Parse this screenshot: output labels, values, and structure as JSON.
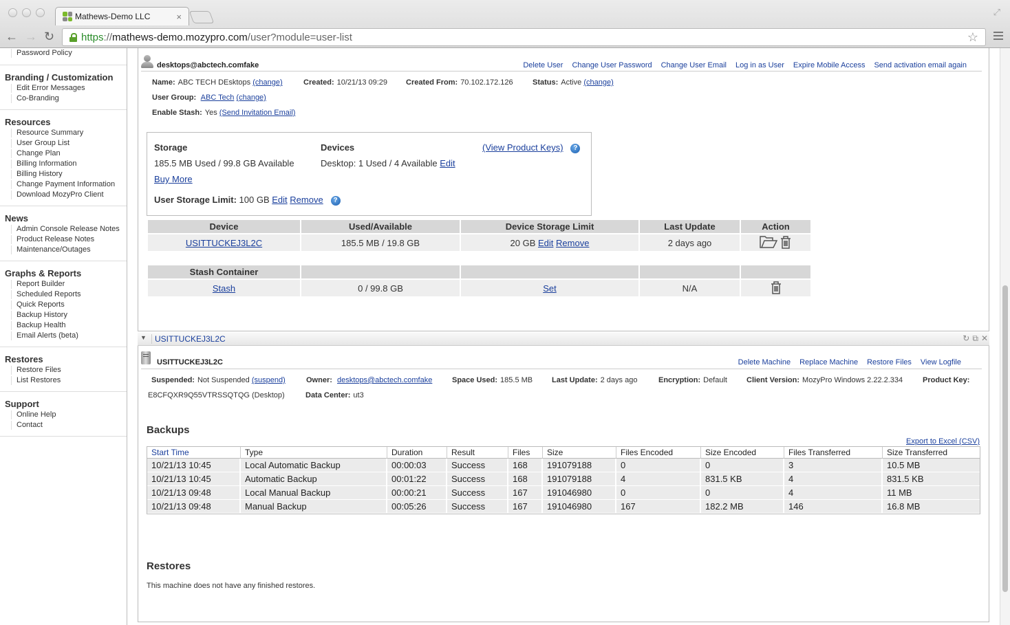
{
  "browser": {
    "tab_title": "Mathews-Demo LLC",
    "tab_close": "×",
    "url_scheme": "https",
    "url_sep": "://",
    "url_host": "mathews-demo.mozypro.com",
    "url_path": "/user?module=user-list",
    "favicon_colors": [
      "#7cba2c",
      "#8a8a8a",
      "#8a8a8a",
      "#7cba2c"
    ]
  },
  "sidebar": {
    "partial_item": "Password Policy",
    "sections": [
      {
        "title": "Branding / Customization",
        "items": [
          "Edit Error Messages",
          "Co-Branding"
        ]
      },
      {
        "title": "Resources",
        "items": [
          "Resource Summary",
          "User Group List",
          "Change Plan",
          "Billing Information",
          "Billing History",
          "Change Payment Information",
          "Download MozyPro Client"
        ]
      },
      {
        "title": "News",
        "items": [
          "Admin Console Release Notes",
          "Product Release Notes",
          "Maintenance/Outages"
        ]
      },
      {
        "title": "Graphs & Reports",
        "items": [
          "Report Builder",
          "Scheduled Reports",
          "Quick Reports",
          "Backup History",
          "Backup Health",
          "Email Alerts (beta)"
        ]
      },
      {
        "title": "Restores",
        "items": [
          "Restore Files",
          "List Restores"
        ]
      },
      {
        "title": "Support",
        "items": [
          "Online Help",
          "Contact"
        ]
      }
    ]
  },
  "user": {
    "email": "desktops@abctech.comfake",
    "actions": [
      "Delete User",
      "Change User Password",
      "Change User Email",
      "Log in as User",
      "Expire Mobile Access",
      "Send activation email again"
    ],
    "name_label": "Name:",
    "name": "ABC TECH DEsktops",
    "change": "(change)",
    "created_label": "Created:",
    "created": "10/21/13 09:29",
    "created_from_label": "Created From:",
    "created_from": "70.102.172.126",
    "status_label": "Status:",
    "status": "Active",
    "group_label": "User Group:",
    "group": "ABC Tech",
    "stash_label": "Enable Stash:",
    "stash": "Yes",
    "send_invite": "(Send Invitation Email)"
  },
  "storage": {
    "title": "Storage",
    "used": "185.5 MB Used / 99.8 GB Available",
    "buy_more": "Buy More",
    "limit_label": "User Storage Limit:",
    "limit": "100 GB",
    "edit": "Edit",
    "remove": "Remove",
    "devices_title": "Devices",
    "devices": "Desktop: 1 Used / 4 Available",
    "view_keys": "(View Product Keys)",
    "help": "?"
  },
  "device_table": {
    "headers": [
      "Device",
      "Used/Available",
      "Device Storage Limit",
      "Last Update",
      "Action"
    ],
    "row": {
      "device": "USITTUCKEJ3L2C",
      "used": "185.5 MB / 19.8 GB",
      "limit": "20 GB",
      "edit": "Edit",
      "remove": "Remove",
      "last_update": "2 days ago"
    },
    "stash_header": "Stash Container",
    "stash_row": {
      "name": "Stash",
      "used": "0 / 99.8 GB",
      "limit": "Set",
      "last_update": "N/A"
    }
  },
  "machine": {
    "bar_title": "USITTUCKEJ3L2C",
    "name": "USITTUCKEJ3L2C",
    "actions": [
      "Delete Machine",
      "Replace Machine",
      "Restore Files",
      "View Logfile"
    ],
    "suspended_label": "Suspended:",
    "suspended": "Not Suspended",
    "suspend_link": "(suspend)",
    "owner_label": "Owner:",
    "owner": "desktops@abctech.comfake",
    "space_label": "Space Used:",
    "space": "185.5 MB",
    "last_update_label": "Last Update:",
    "last_update": "2 days ago",
    "encryption_label": "Encryption:",
    "encryption": "Default",
    "client_label": "Client Version:",
    "client": "MozyPro Windows 2.22.2.334",
    "product_key_label": "Product Key:",
    "product_key": "E8CFQXR9Q55VTRSSQTQG (Desktop)",
    "datacenter_label": "Data Center:",
    "datacenter": "ut3"
  },
  "backups": {
    "title": "Backups",
    "export": "Export to Excel (CSV)",
    "headers": [
      "Start Time",
      "Type",
      "Duration",
      "Result",
      "Files",
      "Size",
      "Files Encoded",
      "Size Encoded",
      "Files Transferred",
      "Size Transferred"
    ],
    "rows": [
      [
        "10/21/13 10:45",
        "Local Automatic Backup",
        "00:00:03",
        "Success",
        "168",
        "191079188",
        "0",
        "0",
        "3",
        "10.5 MB"
      ],
      [
        "10/21/13 10:45",
        "Automatic Backup",
        "00:01:22",
        "Success",
        "168",
        "191079188",
        "4",
        "831.5 KB",
        "4",
        "831.5 KB"
      ],
      [
        "10/21/13 09:48",
        "Local Manual Backup",
        "00:00:21",
        "Success",
        "167",
        "191046980",
        "0",
        "0",
        "4",
        "11 MB"
      ],
      [
        "10/21/13 09:48",
        "Manual Backup",
        "00:05:26",
        "Success",
        "167",
        "191046980",
        "167",
        "182.2 MB",
        "146",
        "16.8 MB"
      ]
    ]
  },
  "restores": {
    "title": "Restores",
    "empty": "This machine does not have any finished restores."
  }
}
